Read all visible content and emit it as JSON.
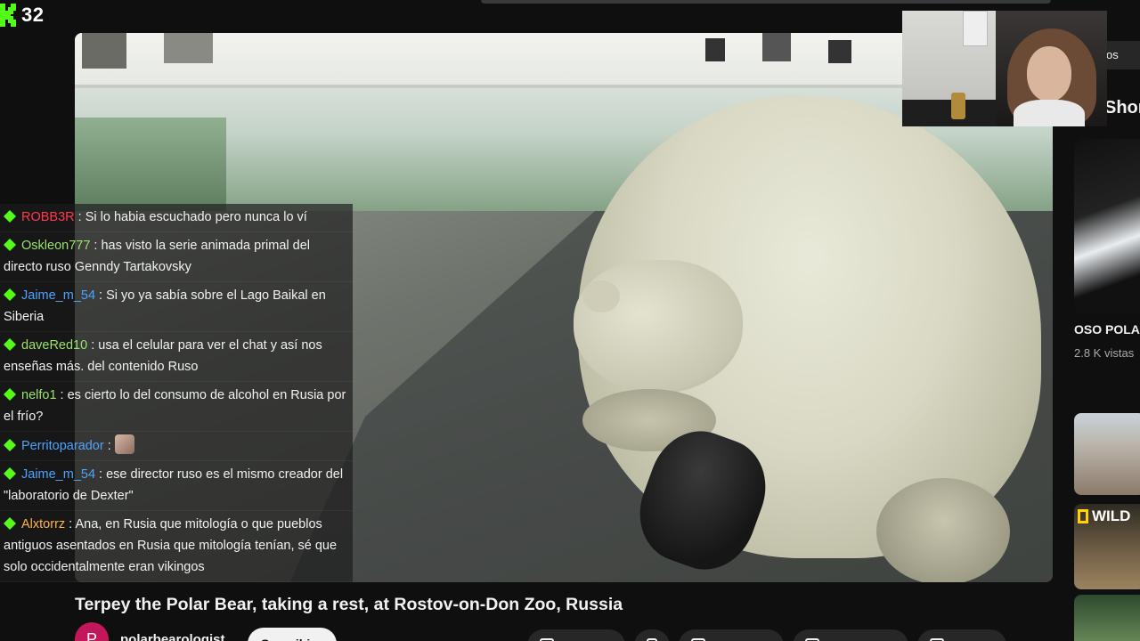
{
  "overlay": {
    "viewer_count": "32"
  },
  "chat": [
    {
      "user": "ROBB3R",
      "color": "#ff3b4e",
      "text": "Si lo habia escuchado pero nunca lo ví"
    },
    {
      "user": "Oskleon777",
      "color": "#9be36d",
      "text": "has visto la serie animada primal del directo ruso Genndy Tartakovsky"
    },
    {
      "user": "Jaime_m_54",
      "color": "#4ea3ff",
      "text": "Si yo ya sabía sobre el Lago Baikal en Siberia"
    },
    {
      "user": "daveRed10",
      "color": "#9be36d",
      "text": "usa el celular para ver el chat y así nos enseñas más. del contenido Ruso"
    },
    {
      "user": "nelfo1",
      "color": "#9be36d",
      "text": "es cierto lo del consumo de alcohol en Rusia por el frío?"
    },
    {
      "user": "Perritoparador",
      "color": "#4ea3ff",
      "text": ""
    },
    {
      "user": "Jaime_m_54",
      "color": "#4ea3ff",
      "text": "ese director ruso es el mismo creador del \"laboratorio de Dexter\""
    },
    {
      "user": "Alxtorrz",
      "color": "#ffb347",
      "text": "Ana, en Rusia que mitología o que pueblos antiguos asentados en Rusia que mitología tenían, sé que solo occidentalmente eran vikingos"
    }
  ],
  "sidebar": {
    "chip_label": "os",
    "shorts_label": "Shor",
    "short_title": "OSO POLA",
    "short_views": "2.8 K vistas",
    "wild_label": "WILD"
  },
  "video": {
    "title": "Terpey the Polar Bear, taking a rest, at Rostov-on-Don Zoo, Russia",
    "channel": "polarbearologist",
    "avatar_letter": "P",
    "subscribe_label": "Suscribirse"
  },
  "colors": {
    "kick_green": "#53fc18",
    "accent_avatar": "#c2185b"
  }
}
